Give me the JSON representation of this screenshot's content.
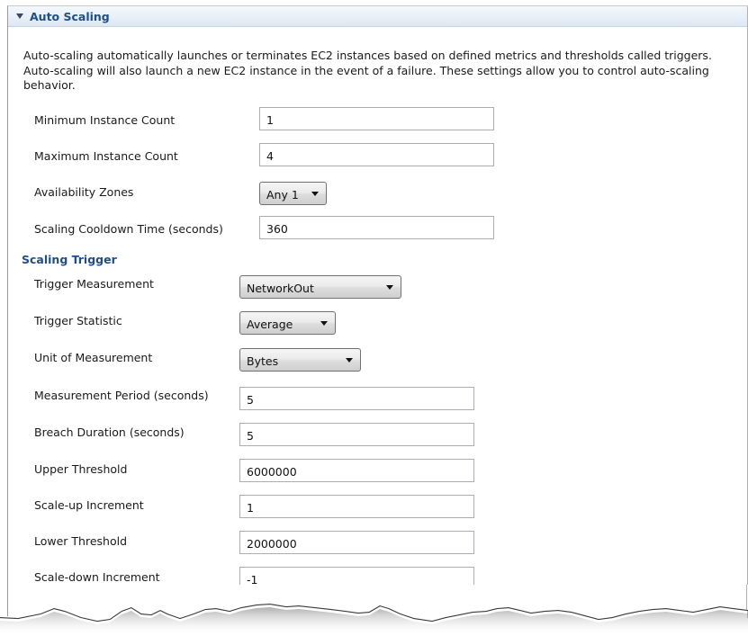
{
  "section": {
    "title": "Auto Scaling",
    "description": "Auto-scaling automatically launches or terminates EC2 instances based on defined metrics and thresholds called triggers. Auto-scaling will also launch a new EC2 instance in the event of a failure. These settings allow you to control auto-scaling behavior."
  },
  "auto_scaling": {
    "min_instance": {
      "label": "Minimum Instance Count",
      "value": "1"
    },
    "max_instance": {
      "label": "Maximum Instance Count",
      "value": "4"
    },
    "availability_zones": {
      "label": "Availability Zones",
      "value": "Any 1"
    },
    "cooldown": {
      "label": "Scaling Cooldown Time (seconds)",
      "value": "360"
    }
  },
  "trigger": {
    "title": "Scaling Trigger",
    "measurement": {
      "label": "Trigger Measurement",
      "value": "NetworkOut"
    },
    "statistic": {
      "label": "Trigger Statistic",
      "value": "Average"
    },
    "unit": {
      "label": "Unit of Measurement",
      "value": "Bytes"
    },
    "period": {
      "label": "Measurement Period (seconds)",
      "value": "5"
    },
    "breach": {
      "label": "Breach Duration (seconds)",
      "value": "5"
    },
    "upper": {
      "label": "Upper Threshold",
      "value": "6000000"
    },
    "scale_up": {
      "label": "Scale-up Increment",
      "value": "1"
    },
    "lower": {
      "label": "Lower Threshold",
      "value": "2000000"
    },
    "scale_down": {
      "label": "Scale-down Increment",
      "value": "-1"
    }
  },
  "icons": {
    "twistie": "triangle-down-icon",
    "dropdown": "chevron-down-icon"
  },
  "colors": {
    "header_text": "#1f4e8a",
    "header_bg": "#dde8f3"
  }
}
